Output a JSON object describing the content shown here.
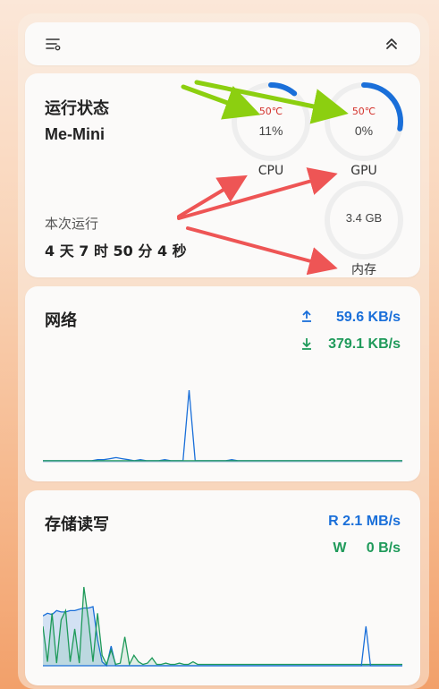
{
  "colors": {
    "upload_blue": "#1a6fd9",
    "download_green": "#1f9a5a",
    "temp_red": "#d4322c",
    "annotation_green": "#8ccf10",
    "annotation_red": "#ee5555"
  },
  "topbar": {
    "menu_icon": "filter-list-icon",
    "collapse_icon": "double-chevron-up-icon"
  },
  "status": {
    "title": "运行状态",
    "device": "Me-Mini",
    "uptime_label": "本次运行",
    "uptime_value": "4 天 7 时 50 分 4 秒",
    "cpu": {
      "temp": "50℃",
      "usage": "11%",
      "label": "CPU",
      "fraction": 0.11
    },
    "gpu": {
      "temp": "50℃",
      "usage": "0%",
      "label": "GPU",
      "fraction": 0.28
    },
    "mem": {
      "value": "3.4 GB",
      "label": "内存",
      "fraction": 0.0
    }
  },
  "network": {
    "title": "网络",
    "upload": "59.6 KB/s",
    "download": "379.1 KB/s",
    "upload_icon": "upload-arrow-icon",
    "download_icon": "download-arrow-icon"
  },
  "storage": {
    "title": "存储读写",
    "read": "R 2.1 MB/s",
    "write": "W     0 B/s"
  },
  "chart_data": [
    {
      "type": "line",
      "series": [
        {
          "values": [
            1,
            1,
            1,
            1,
            1,
            1,
            1,
            1,
            1,
            2,
            2,
            3,
            4,
            3,
            2,
            1,
            2,
            1,
            1,
            1,
            2,
            1,
            1,
            1,
            70,
            1,
            1,
            1,
            1,
            1,
            1,
            2,
            1,
            1,
            1,
            1,
            1,
            1,
            1,
            1,
            1,
            1,
            1,
            1,
            1,
            1,
            1,
            1,
            1,
            1,
            1,
            1,
            1,
            1,
            1,
            1,
            1,
            1,
            1,
            1
          ]
        },
        {
          "values": [
            1,
            1,
            1,
            1,
            1,
            1,
            1,
            1,
            1,
            1,
            1,
            1,
            1,
            1,
            1,
            1,
            1,
            1,
            1,
            1,
            1,
            1,
            1,
            1,
            1,
            1,
            1,
            1,
            1,
            1,
            1,
            1,
            1,
            1,
            1,
            1,
            1,
            1,
            1,
            1,
            1,
            1,
            1,
            1,
            1,
            1,
            1,
            1,
            1,
            1,
            1,
            1,
            1,
            1,
            1,
            1,
            1,
            1,
            1,
            1
          ]
        }
      ]
    },
    {
      "type": "area",
      "series": [
        {
          "values": [
            38,
            40,
            39,
            42,
            41,
            41,
            42,
            42,
            43,
            44,
            44,
            45,
            20,
            3,
            0,
            15,
            0,
            0,
            0,
            0,
            0,
            0,
            0,
            0,
            0,
            0,
            0,
            0,
            0,
            0,
            0,
            0,
            0,
            0,
            0,
            0,
            0,
            0,
            0,
            0,
            0,
            0,
            0,
            0,
            0,
            0,
            0,
            0,
            0,
            0,
            0,
            0,
            0,
            0,
            0,
            0,
            0,
            0,
            0,
            0,
            0,
            0,
            0,
            0,
            0,
            0,
            0,
            0,
            0,
            0,
            0,
            0,
            0,
            0,
            0,
            0,
            0,
            0,
            0,
            0
          ]
        },
        {
          "values": [
            30,
            3,
            40,
            2,
            35,
            42,
            3,
            28,
            2,
            60,
            35,
            3,
            40,
            8,
            1,
            12,
            1,
            2,
            22,
            1,
            8,
            3,
            1,
            2,
            6,
            1,
            1,
            2,
            1,
            1,
            2,
            1,
            1,
            3,
            1,
            1,
            1,
            1,
            1,
            1,
            1,
            1,
            1,
            1,
            1,
            1,
            1,
            1,
            1,
            1,
            1,
            1,
            1,
            1,
            1,
            1,
            1,
            1,
            1,
            1,
            1,
            1,
            1,
            1,
            1,
            1,
            1,
            1,
            1,
            1,
            1,
            1,
            1,
            1,
            1,
            1,
            1,
            1,
            1,
            1
          ]
        },
        {
          "values": [
            0,
            0,
            0,
            0,
            0,
            0,
            0,
            0,
            0,
            0,
            0,
            0,
            0,
            0,
            0,
            0,
            0,
            0,
            0,
            0,
            0,
            0,
            0,
            0,
            0,
            0,
            0,
            0,
            0,
            0,
            0,
            0,
            0,
            0,
            0,
            0,
            0,
            0,
            0,
            0,
            0,
            0,
            0,
            0,
            0,
            0,
            0,
            0,
            0,
            0,
            0,
            0,
            0,
            0,
            0,
            0,
            0,
            0,
            0,
            0,
            0,
            0,
            0,
            0,
            0,
            0,
            0,
            0,
            0,
            0,
            0,
            30,
            0,
            0,
            0,
            0,
            0,
            0,
            0,
            0
          ]
        }
      ]
    }
  ]
}
